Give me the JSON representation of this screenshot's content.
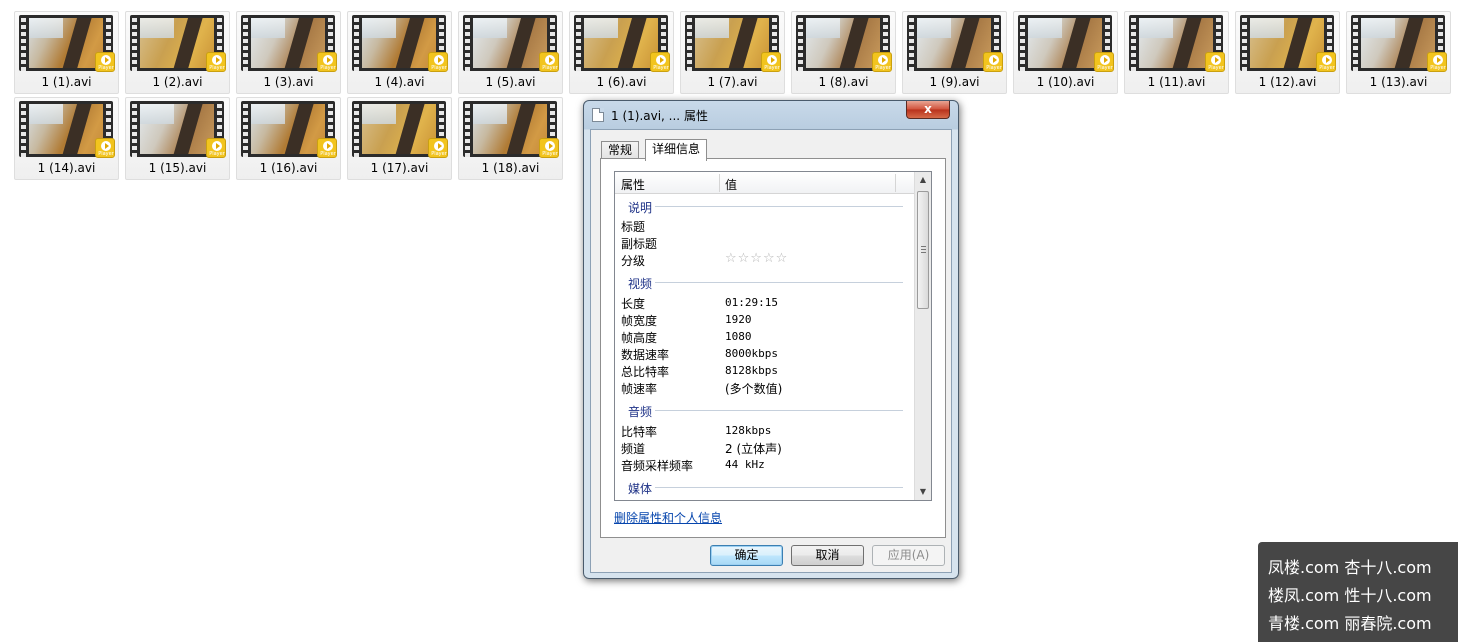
{
  "files": [
    {
      "name": "1 (1).avi"
    },
    {
      "name": "1 (2).avi"
    },
    {
      "name": "1 (3).avi"
    },
    {
      "name": "1 (4).avi"
    },
    {
      "name": "1 (5).avi"
    },
    {
      "name": "1 (6).avi"
    },
    {
      "name": "1 (7).avi"
    },
    {
      "name": "1 (8).avi"
    },
    {
      "name": "1 (9).avi"
    },
    {
      "name": "1 (10).avi"
    },
    {
      "name": "1 (11).avi"
    },
    {
      "name": "1 (12).avi"
    },
    {
      "name": "1 (13).avi"
    },
    {
      "name": "1 (14).avi"
    },
    {
      "name": "1 (15).avi"
    },
    {
      "name": "1 (16).avi"
    },
    {
      "name": "1 (17).avi"
    },
    {
      "name": "1 (18).avi"
    }
  ],
  "file_badge_text": "Player",
  "dialog": {
    "title": "1 (1).avi, ... 属性",
    "close_label": "x",
    "tabs": [
      {
        "label": "常规",
        "active": false
      },
      {
        "label": "详细信息",
        "active": true
      }
    ],
    "columns": {
      "property": "属性",
      "value": "值"
    },
    "sections": {
      "description": "说明",
      "video": "视频",
      "audio": "音频",
      "media": "媒体"
    },
    "properties": {
      "title": {
        "label": "标题",
        "value": ""
      },
      "subtitle": {
        "label": "副标题",
        "value": ""
      },
      "rating": {
        "label": "分级",
        "stars": "☆☆☆☆☆",
        "rating": 0
      },
      "length": {
        "label": "长度",
        "value": "01:29:15"
      },
      "frame_width": {
        "label": "帧宽度",
        "value": "1920"
      },
      "frame_height": {
        "label": "帧高度",
        "value": "1080"
      },
      "data_rate": {
        "label": "数据速率",
        "value": "8000kbps"
      },
      "total_bitrate": {
        "label": "总比特率",
        "value": "8128kbps"
      },
      "frame_rate": {
        "label": "帧速率",
        "value": "(多个数值)"
      },
      "bitrate": {
        "label": "比特率",
        "value": "128kbps"
      },
      "channels": {
        "label": "频道",
        "value": "2 (立体声)"
      },
      "sample_rate": {
        "label": "音频采样频率",
        "value": "44 kHz"
      }
    },
    "remove_link": "删除属性和个人信息",
    "buttons": {
      "ok": "确定",
      "cancel": "取消",
      "apply": "应用(A)"
    }
  },
  "watermark": {
    "lines": [
      "凤楼.com  杏十八.com",
      "楼凤.com  性十八.com",
      "青楼.com  丽春院.com"
    ]
  }
}
